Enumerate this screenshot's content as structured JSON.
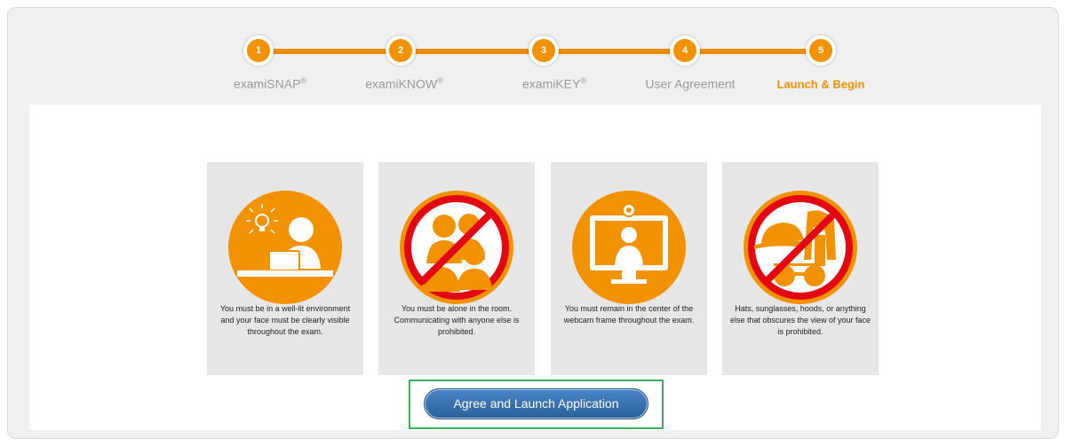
{
  "steps": [
    {
      "number": "1",
      "label": "examiSNAP",
      "mark": "®"
    },
    {
      "number": "2",
      "label": "examiKNOW",
      "mark": "®"
    },
    {
      "number": "3",
      "label": "examiKEY",
      "mark": "®"
    },
    {
      "number": "4",
      "label": "User Agreement",
      "mark": ""
    },
    {
      "number": "5",
      "label": "Launch & Begin",
      "mark": ""
    }
  ],
  "active_step": 5,
  "cards": [
    {
      "icon": "well-lit-person-laptop-icon",
      "text": "You must be in a well-lit environment and your face must be clearly visible throughout the exam."
    },
    {
      "icon": "no-other-people-icon",
      "text": "You must be alone in the room. Communicating with anyone else is prohibited."
    },
    {
      "icon": "centered-in-webcam-icon",
      "text": "You must remain in the center of the webcam frame throughout the exam."
    },
    {
      "icon": "no-hats-sunglasses-hoods-icon",
      "text": "Hats, sunglasses, hoods, or anything else that obscures the view of your face is prohibited."
    }
  ],
  "launch_button": {
    "label": "Agree and Launch Application"
  },
  "colors": {
    "accent": "#f39200",
    "prohibit": "#e30613",
    "button": "#3a72b0",
    "focus": "#3cae5a"
  }
}
